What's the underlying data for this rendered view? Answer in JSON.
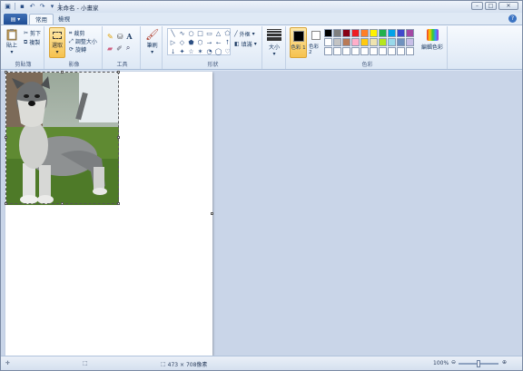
{
  "window": {
    "title": "未命名 - 小畫家",
    "controls": [
      "–",
      "□",
      "✕"
    ]
  },
  "tabs": {
    "app_menu_icon": "paint-menu-icon",
    "items": [
      {
        "label": "常用",
        "active": true
      },
      {
        "label": "檢視",
        "active": false
      }
    ]
  },
  "ribbon": {
    "clipboard": {
      "label": "剪貼簿",
      "paste": "貼上",
      "cut": "剪下",
      "copy": "複製"
    },
    "image": {
      "label": "影像",
      "select": "選取",
      "crop": "裁剪",
      "resize": "調整大小",
      "rotate": "旋轉"
    },
    "tools": {
      "label": "工具",
      "items": [
        "pencil-icon",
        "fill-icon",
        "text-icon",
        "eraser-icon",
        "color-picker-icon",
        "magnifier-icon"
      ]
    },
    "brushes": {
      "label": "筆刷"
    },
    "shapes": {
      "label": "形狀",
      "outline": "外框",
      "fill": "填滿",
      "glyphs": [
        "╲",
        "∿",
        "○",
        "□",
        "▭",
        "△",
        "⬠",
        "▷",
        "◇",
        "⬟",
        "⬡",
        "⭢",
        "⭠",
        "⭡",
        "⭣",
        "✦",
        "☆",
        "✶",
        "◔",
        "◯",
        "♡"
      ]
    },
    "size": {
      "label": "大小"
    },
    "colors": {
      "label": "色彩",
      "color1": "色彩 1",
      "color2": "色彩 2",
      "edit": "編輯色彩",
      "swatches": [
        "#000000",
        "#7f7f7f",
        "#880015",
        "#ed1c24",
        "#ff7f27",
        "#fff200",
        "#22b14c",
        "#00a2e8",
        "#3f48cc",
        "#a349a4",
        "#ffffff",
        "#c3c3c3",
        "#b97a57",
        "#ffaec9",
        "#ffc90e",
        "#efe4b0",
        "#b5e61d",
        "#99d9ea",
        "#7092be",
        "#c8bfe7",
        "#ffffff",
        "#ffffff",
        "#ffffff",
        "#ffffff",
        "#ffffff",
        "#ffffff",
        "#ffffff",
        "#ffffff",
        "#ffffff",
        "#ffffff"
      ]
    }
  },
  "status": {
    "dimensions": "473 × 708像素",
    "zoom": "100%",
    "zoom_fraction": 0.5
  }
}
